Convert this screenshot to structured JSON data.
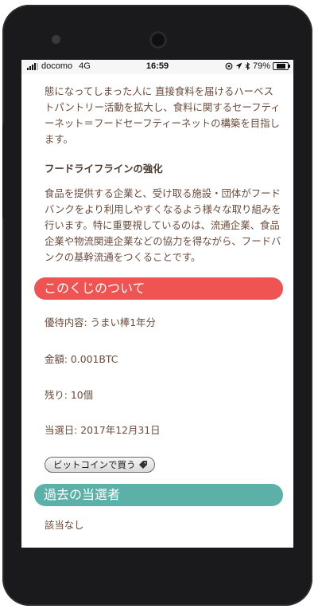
{
  "status_bar": {
    "carrier": "docomo",
    "network": "4G",
    "time": "16:59",
    "battery": "79%",
    "battery_level": 0.79
  },
  "article": {
    "paragraph1": "態になってしまった人に 直接食料を届けるハーベストパントリー活動を拡大し、食料に関するセーフティーネット＝フードセーフティーネットの構築を目指します。",
    "heading": "フードライフラインの強化",
    "paragraph2": "食品を提供する企業と、受け取る施設・団体がフードバンクをより利用しやすくなるよう様々な取り組みを行います。特に重要視しているのは、流通企業、食品企業や物流関連企業などの協力を得ながら、フードバンクの基幹流通をつくることです。"
  },
  "lottery": {
    "title": "このくじのついて",
    "benefit": "優待内容: うまい棒1年分",
    "amount": "金額: 0.001BTC",
    "remaining": "残り: 10個",
    "draw_date": "当選日: 2017年12月31日",
    "buy_button": "ビットコインで買う"
  },
  "winners": {
    "title": "過去の当選者",
    "empty_text": "該当なし"
  },
  "colors": {
    "red_band": "#ef5452",
    "teal_band": "#5bb1a8",
    "body_text": "#6b4a3a"
  },
  "icons": [
    "signal-icon",
    "location-icon",
    "bluetooth-icon",
    "battery-icon",
    "tag-icon"
  ]
}
